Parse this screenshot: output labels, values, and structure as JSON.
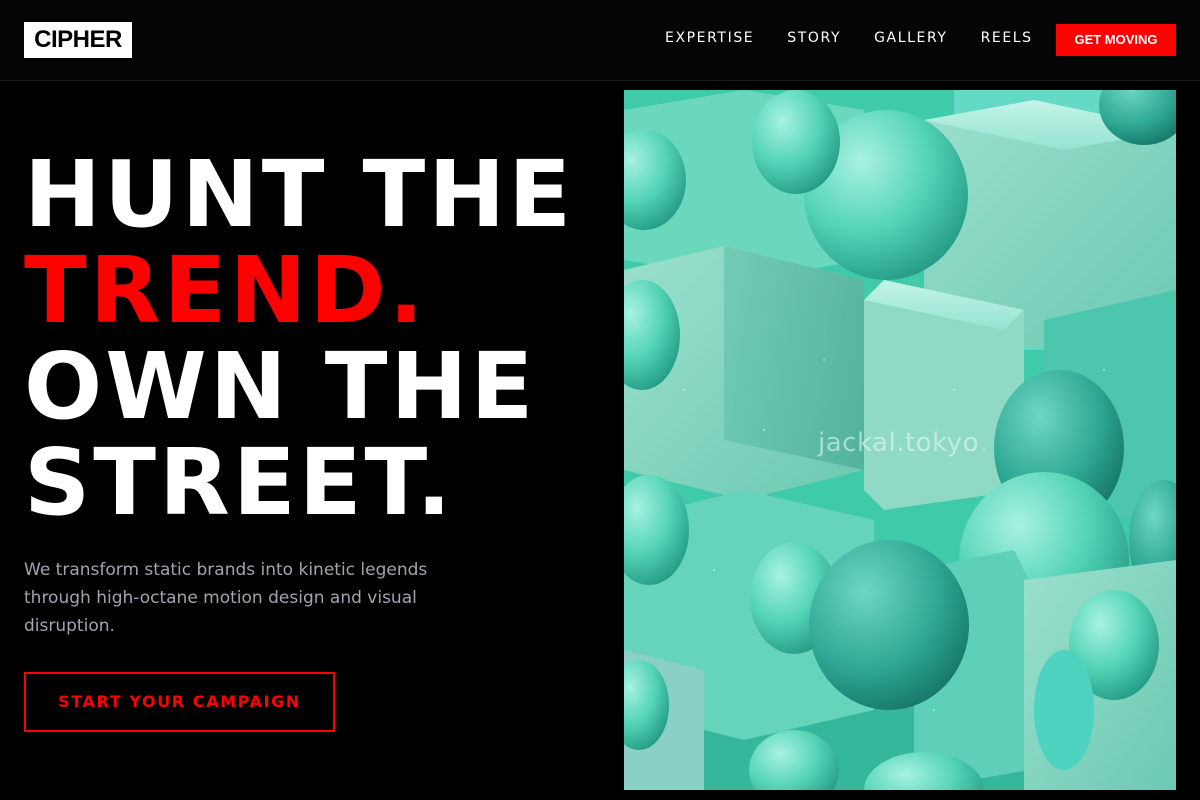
{
  "header": {
    "logo": "CIPHER",
    "nav": [
      "EXPERTISE",
      "STORY",
      "GALLERY",
      "REELS"
    ],
    "cta": "GET MOVING"
  },
  "hero": {
    "headline": {
      "line1": "HUNT THE",
      "line2": "TREND.",
      "line3": "OWN THE",
      "line4": "STREET."
    },
    "subtext": "We transform static brands into kinetic legends through high-octane motion design and visual disruption.",
    "cta": "START YOUR CAMPAIGN",
    "image_watermark": "jackal.tokyo"
  },
  "colors": {
    "accent": "#ff0000",
    "background": "#000000",
    "text": "#ffffff",
    "muted_text": "#a3a3b0",
    "image_teal": "#3cc9a8"
  }
}
